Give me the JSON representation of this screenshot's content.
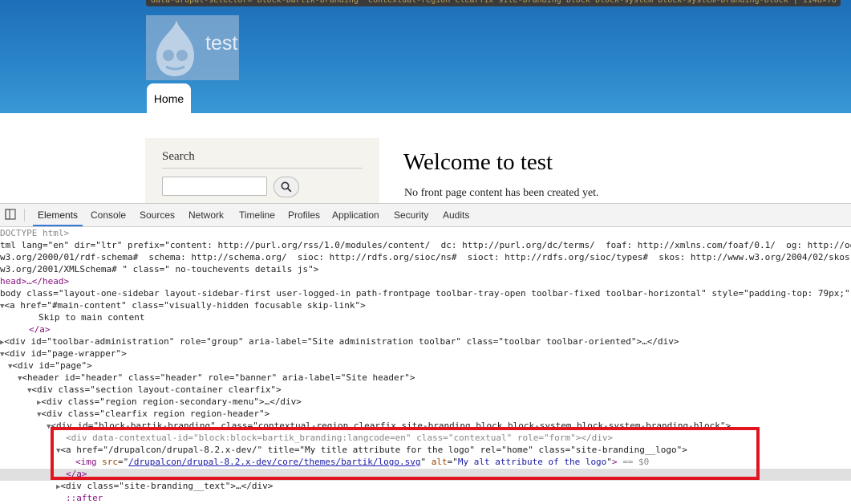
{
  "site": {
    "name": "test",
    "tooltip_text": "data-drupal-selector=\"block-bartik-branding\" contextual-region clearfix site-branding block block-system block-system-branding-block | 1148×78",
    "nav": {
      "home_label": "Home"
    }
  },
  "search_block": {
    "title": "Search",
    "input_value": ""
  },
  "main": {
    "title": "Welcome to test",
    "message": "No front page content has been created yet."
  },
  "devtools": {
    "tabs": [
      "Elements",
      "Console",
      "Sources",
      "Network",
      "Timeline",
      "Profiles",
      "Application",
      "Security",
      "Audits"
    ],
    "active_tab": "Elements",
    "lines": {
      "l0": "DOCTYPE html>",
      "l1a": "tml lang=\"en\" dir=\"ltr\" prefix=\"content: http://purl.org/rss/1.0/modules/content/  dc: http://purl.org/dc/terms/  foaf: http://xmlns.com/foaf/0.1/  og: http://og",
      "l1b": "w3.org/2000/01/rdf-schema#  schema: http://schema.org/  sioc: http://rdfs.org/sioc/ns#  sioct: http://rdfs.org/sioc/types#  skos: http://www.w3.org/2004/02/skos",
      "l1c": "w3.org/2001/XMLSchema# \" class=\" no-touchevents details js\">",
      "l2": "head>…</head>",
      "l3": "body class=\"layout-one-sidebar layout-sidebar-first user-logged-in path-frontpage toolbar-tray-open toolbar-fixed toolbar-horizontal\" style=\"padding-top: 79px;\"",
      "l4": "<a href=\"#main-content\" class=\"visually-hidden focusable skip-link\">",
      "l5": "Skip to main content",
      "l6": "</a>",
      "l7": "<div id=\"toolbar-administration\" role=\"group\" aria-label=\"Site administration toolbar\" class=\"toolbar toolbar-oriented\">…</div>",
      "l8": "<div id=\"page-wrapper\">",
      "l9": "<div id=\"page\">",
      "l10": "<header id=\"header\" class=\"header\" role=\"banner\" aria-label=\"Site header\">",
      "l11": "<div class=\"section layout-container clearfix\">",
      "l12": "<div class=\"region region-secondary-menu\">…</div>",
      "l13": "<div class=\"clearfix region region-header\">",
      "l14": "<div id=\"block-bartik-branding\" class=\"contextual-region clearfix site-branding block block-system block-system-branding-block\">",
      "l15": "<div data-contextual-id=\"block:block=bartik_branding:langcode=en\" class=\"contextual\" role=\"form\"></div>",
      "l16": "<a href=\"/drupalcon/drupal-8.2.x-dev/\" title=\"My title attribute for the logo\" rel=\"home\" class=\"site-branding__logo\">",
      "l17_src": "/drupalcon/drupal-8.2.x-dev/core/themes/bartik/logo.svg",
      "l17_alt": "My alt attribute of the logo",
      "l17_sel": "== $0",
      "l18": "</a>",
      "l19": "<div class=\"site-branding__text\">…</div>",
      "l20": "::after"
    }
  }
}
